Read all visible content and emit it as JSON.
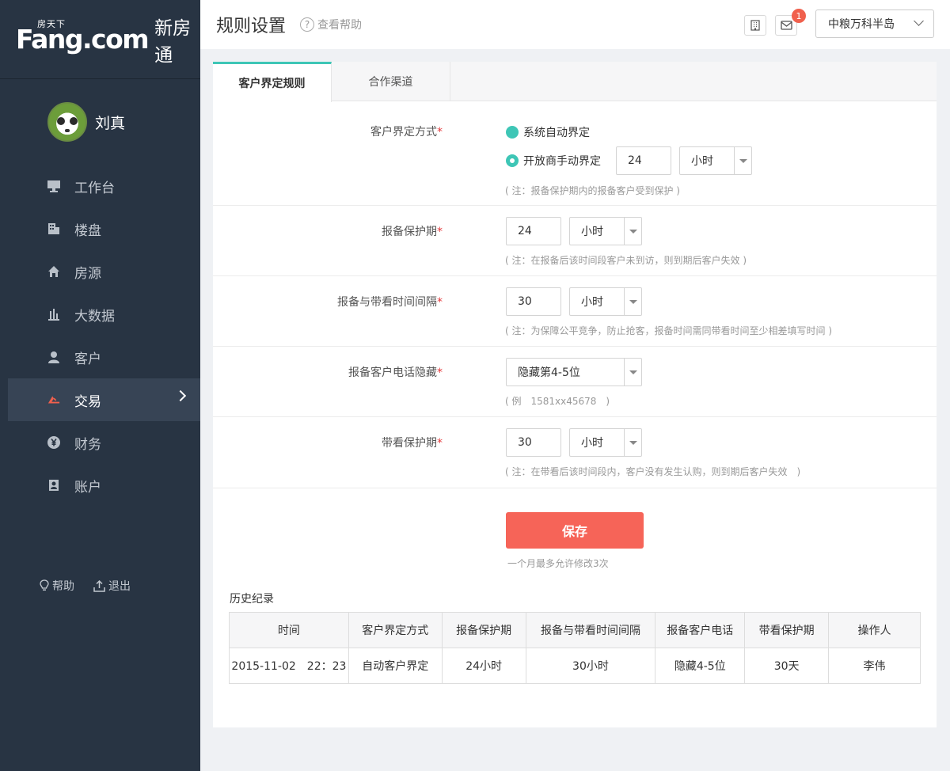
{
  "brand": {
    "logo_small": "房天下",
    "logo_main": "Fang.com",
    "product": "新房通"
  },
  "user": {
    "name": "刘真"
  },
  "nav": [
    {
      "label": "工作台",
      "icon": "monitor-icon"
    },
    {
      "label": "楼盘",
      "icon": "building-icon"
    },
    {
      "label": "房源",
      "icon": "house-icon"
    },
    {
      "label": "大数据",
      "icon": "bar-chart-icon"
    },
    {
      "label": "客户",
      "icon": "person-icon"
    },
    {
      "label": "交易",
      "icon": "deal-icon",
      "active": true
    },
    {
      "label": "财务",
      "icon": "yen-icon"
    },
    {
      "label": "账户",
      "icon": "account-icon"
    }
  ],
  "footer": {
    "help": "帮助",
    "logout": "退出"
  },
  "header": {
    "title": "规则设置",
    "help_link": "查看帮助",
    "badge_count": "1",
    "project": "中粮万科半岛"
  },
  "tabs": [
    "客户界定规则",
    "合作渠道"
  ],
  "form": {
    "define": {
      "label": "客户界定方式",
      "opt1": "系统自动界定",
      "opt2": "开放商手动界定",
      "value": "24",
      "unit": "小时",
      "note": "( 注：报备保护期内的报备客户受到保护 )"
    },
    "report": {
      "label": "报备保护期",
      "value": "24",
      "unit": "小时",
      "note": "( 注：在报备后该时间段客户未到访，则到期后客户失效 )"
    },
    "interval": {
      "label": "报备与带看时间间隔",
      "value": "30",
      "unit": "小时",
      "note": "( 注：为保障公平竞争，防止抢客，报备时间需同带看时间至少相差填写时间 )"
    },
    "phone": {
      "label": "报备客户电话隐藏",
      "value": "隐藏第4-5位",
      "note": "( 例　1581xx45678　)"
    },
    "visit": {
      "label": "带看保护期",
      "value": "30",
      "unit": "小时",
      "note": "( 注：在带看后该时间段内，客户没有发生认购，则到期后客户失效　)"
    },
    "required_mark": "*"
  },
  "save": {
    "label": "保存",
    "hint": "一个月最多允许修改3次"
  },
  "history": {
    "title": "历史纪录",
    "columns": [
      "时间",
      "客户界定方式",
      "报备保护期",
      "报备与带看时间间隔",
      "报备客户电话",
      "带看保护期",
      "操作人"
    ],
    "rows": [
      [
        "2015-11-02　22：23",
        "自动客户界定",
        "24小时",
        "30小时",
        "隐藏4-5位",
        "30天",
        "李伟"
      ]
    ]
  }
}
